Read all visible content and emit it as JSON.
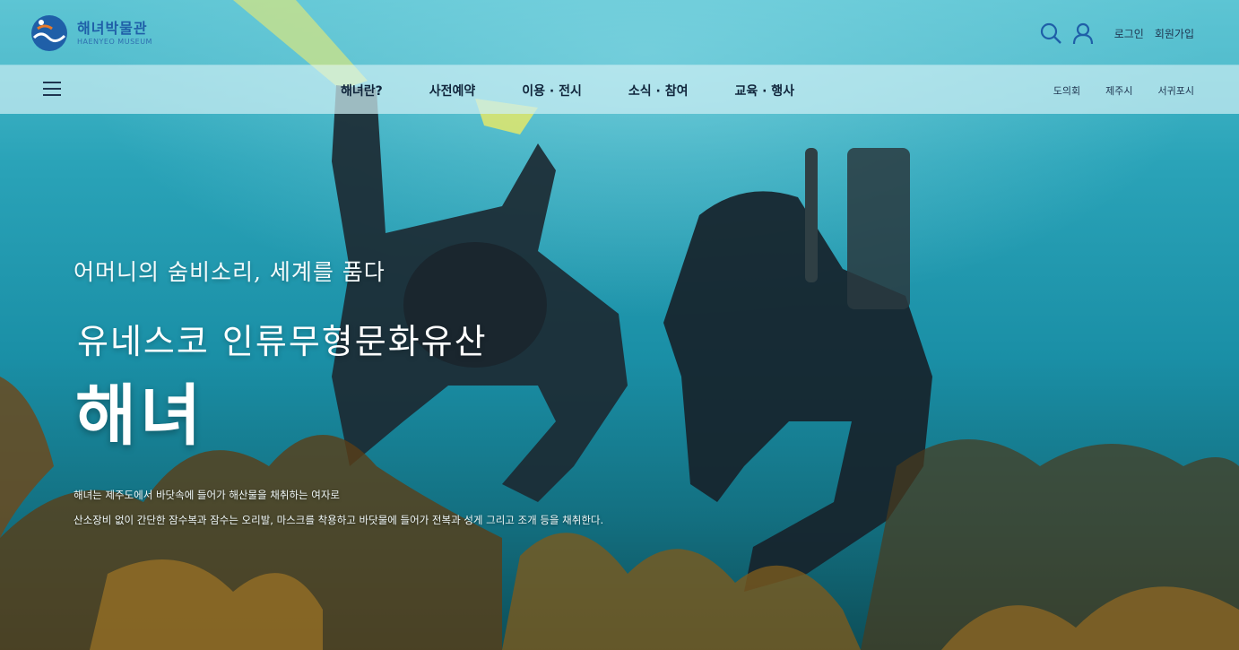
{
  "logo": {
    "name_ko": "해녀박물관",
    "name_en": "HAENYEO MUSEUM"
  },
  "header": {
    "login": "로그인",
    "signup": "회원가입"
  },
  "nav": {
    "main": [
      "해녀란?",
      "사전예약",
      "이용 · 전시",
      "소식 · 참여",
      "교육 · 행사"
    ],
    "regions": [
      "도의회",
      "제주시",
      "서귀포시"
    ]
  },
  "hero": {
    "subtitle": "어머니의 숨비소리, 세계를 품다",
    "line": "유네스코 인류무형문화유산",
    "title": "해녀",
    "desc_1": "해녀는 제주도에서 바닷속에 들어가 해산물을 채취하는 여자로",
    "desc_2": "산소장비 없이 간단한 잠수복과 잠수는 오리발, 마스크를 착용하고 바닷물에 들어가 전복과 성게 그리고 조개 등을 채취한다."
  },
  "colors": {
    "brand": "#1f5fa8",
    "nav_text": "#10253b",
    "sea_top": "#4fc0cf",
    "sea_bottom": "#0d4e58"
  }
}
